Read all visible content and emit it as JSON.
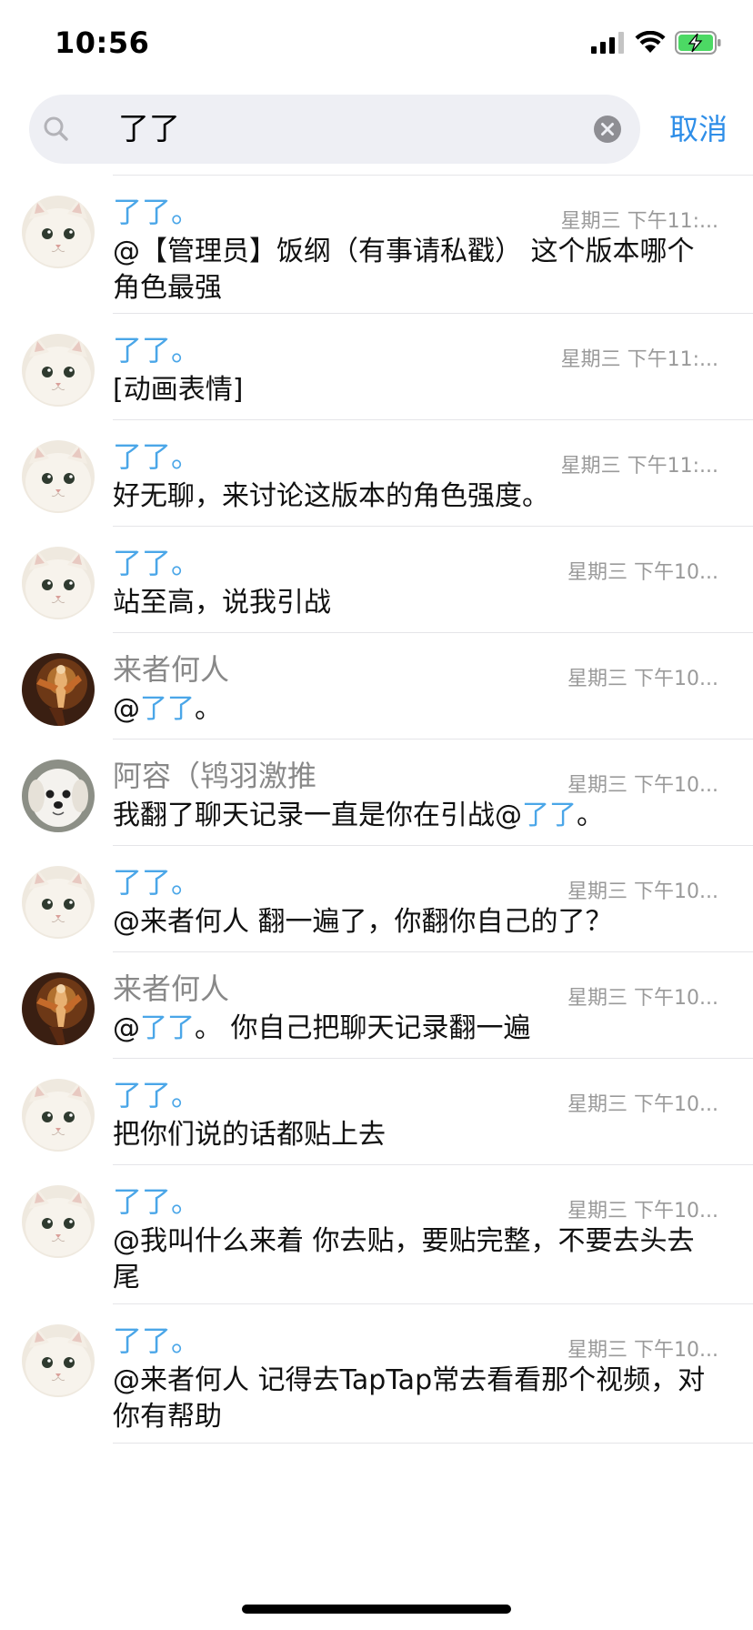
{
  "status_bar": {
    "time": "10:56",
    "icons": [
      "signal-icon",
      "wifi-icon",
      "battery-charging-icon"
    ],
    "battery_color": "#4cd964"
  },
  "search": {
    "query": "了了",
    "cancel_label": "取消"
  },
  "colors": {
    "accent": "#2e8ee8",
    "self_name": "#4aa6e8",
    "other_name": "#888888"
  },
  "results": [
    {
      "name": "了了。",
      "avatar": "white-cat",
      "time": "星期三 下午11:...",
      "segments": [
        {
          "text": "@【管理员】饭纲（有事请私戳） 这个版本哪个角色最强"
        }
      ]
    },
    {
      "name": "了了。",
      "avatar": "white-cat",
      "time": "星期三 下午11:...",
      "segments": [
        {
          "text": "[动画表情]"
        }
      ]
    },
    {
      "name": "了了。",
      "avatar": "white-cat",
      "time": "星期三 下午11:...",
      "segments": [
        {
          "text": "好无聊，来讨论这版本的角色强度。"
        }
      ]
    },
    {
      "name": "了了。",
      "avatar": "white-cat",
      "time": "星期三 下午10...",
      "segments": [
        {
          "text": "站至高，说我引战"
        }
      ]
    },
    {
      "name": "来者何人",
      "avatar": "warrior-art",
      "time": "星期三 下午10...",
      "segments": [
        {
          "text": "@"
        },
        {
          "text": "了了",
          "mention": true
        },
        {
          "text": "。"
        }
      ]
    },
    {
      "name": "阿容（鸨羽激推",
      "avatar": "puppy",
      "time": "星期三 下午10...",
      "segments": [
        {
          "text": "我翻了聊天记录一直是你在引战@"
        },
        {
          "text": "了了",
          "mention": true
        },
        {
          "text": "。"
        }
      ]
    },
    {
      "name": "了了。",
      "avatar": "white-cat",
      "time": "星期三 下午10...",
      "segments": [
        {
          "text": "@来者何人 翻一遍了，你翻你自己的了？"
        }
      ]
    },
    {
      "name": "来者何人",
      "avatar": "warrior-art",
      "time": "星期三 下午10...",
      "segments": [
        {
          "text": "@"
        },
        {
          "text": "了了",
          "mention": true
        },
        {
          "text": "。 你自己把聊天记录翻一遍"
        }
      ]
    },
    {
      "name": "了了。",
      "avatar": "white-cat",
      "time": "星期三 下午10...",
      "segments": [
        {
          "text": "把你们说的话都贴上去"
        }
      ]
    },
    {
      "name": "了了。",
      "avatar": "white-cat",
      "time": "星期三 下午10...",
      "segments": [
        {
          "text": "@我叫什么来着 你去贴，要贴完整，不要去头去尾"
        }
      ]
    },
    {
      "name": "了了。",
      "avatar": "white-cat",
      "time": "星期三 下午10...",
      "segments": [
        {
          "text": "@来者何人 记得去TapTap常去看看那个视频，对你有帮助"
        }
      ]
    }
  ]
}
